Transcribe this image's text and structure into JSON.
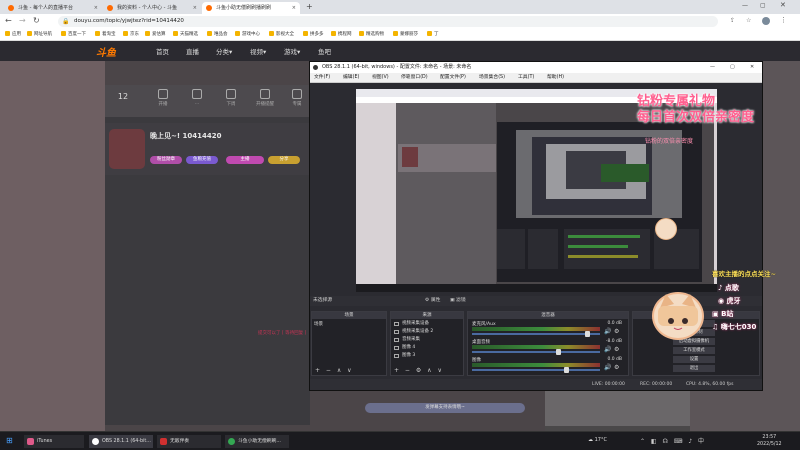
{
  "tabs": [
    {
      "label": "斗鱼 - 每个人的直播平台"
    },
    {
      "label": "我的资料 - 个人中心 - 斗鱼"
    },
    {
      "label": "斗鱼小助无偿刷刷播刷刷"
    }
  ],
  "address": {
    "url": "douyu.com/topic/yjwjtez?rid=10414420"
  },
  "bookmarks": [
    "应用",
    "网址导航",
    "百度一下",
    "着淘宝",
    "京东",
    "爱估算",
    "天猫精选",
    "唯品会",
    "游戏中心",
    "影视大全",
    "拼多多",
    "携程网",
    "精选购物",
    "蒙娜丽莎",
    "丁"
  ],
  "site": {
    "logo": "斗鱼",
    "nav": [
      "首页",
      "直播",
      "分类▾",
      "视频▾",
      "游戏▾",
      "鱼吧"
    ],
    "tiles": [
      "12",
      "开播",
      "…",
      "下周",
      "开播提醒",
      "专属"
    ],
    "counter": "12",
    "streamer": "晚上见~! 10414420",
    "pills": [
      "粉丝勋章",
      "鱼粮充值",
      "主播",
      "分享"
    ],
    "dim_text": "提交可以了 [ 等待回复 ]",
    "tip": "发弹幕支持表情哦~"
  },
  "obs": {
    "title": "OBS 28.1.1 (64-bit, windows) - 配置文件: 未命名 - 场景: 未命名",
    "menu": [
      "文件(F)",
      "编辑(E)",
      "视图(V)",
      "停靠窗口(D)",
      "配置文件(P)",
      "场景集合(S)",
      "工具(T)",
      "帮助(H)"
    ],
    "source_bar": "未选择源",
    "source_bar_btns": [
      "⚙ 属性",
      "▣ 滤镜"
    ],
    "docks": {
      "scenes": "场景",
      "sources": "来源",
      "mixer": "混音器",
      "controls": "控件"
    },
    "scene_items": [
      "场景"
    ],
    "source_items": [
      "视频采集设备",
      "视频采集设备 2",
      "音频采集",
      "图像 4",
      "图像 3"
    ],
    "mixer": [
      {
        "name": "麦克风/Aux",
        "db": "0.0 dB",
        "level": 0.92
      },
      {
        "name": "桌面音频",
        "db": "-8.0 dB",
        "level": 0.68
      },
      {
        "name": "图像",
        "db": "0.0 dB",
        "level": 0.75
      }
    ],
    "controls": [
      "开始直播",
      "开始录制",
      "启动虚拟摄像机",
      "工作室模式",
      "设置",
      "退出"
    ],
    "status": {
      "dropped": "LIVE: 00:00:00",
      "rec": "REC: 00:00:00",
      "cpu": "CPU: 4.8%, 60.00 fps"
    }
  },
  "overlay": {
    "line1": "钻粉专属礼物",
    "line2": "每日首次双倍亲密度",
    "line3": "钻粉的双倍亲密度",
    "follow_title": "喜欢主播的点点关注~",
    "platforms": [
      "点歌",
      "虎牙",
      "B站",
      "嗨七七030"
    ]
  },
  "taskbar": {
    "items": [
      {
        "label": "iTunes"
      },
      {
        "label": "OBS 28.1.1 (64-bit..."
      },
      {
        "label": "无敌伴奏"
      },
      {
        "label": "斗鱼小助无偿刷刷..."
      }
    ],
    "weather": "17°C",
    "time": "23:57",
    "date": "2022/5/12"
  },
  "colors": {
    "accent": "#ff7a00",
    "overlay_pink": "#ff5f8f",
    "obs_bg": "#2b2b31"
  }
}
